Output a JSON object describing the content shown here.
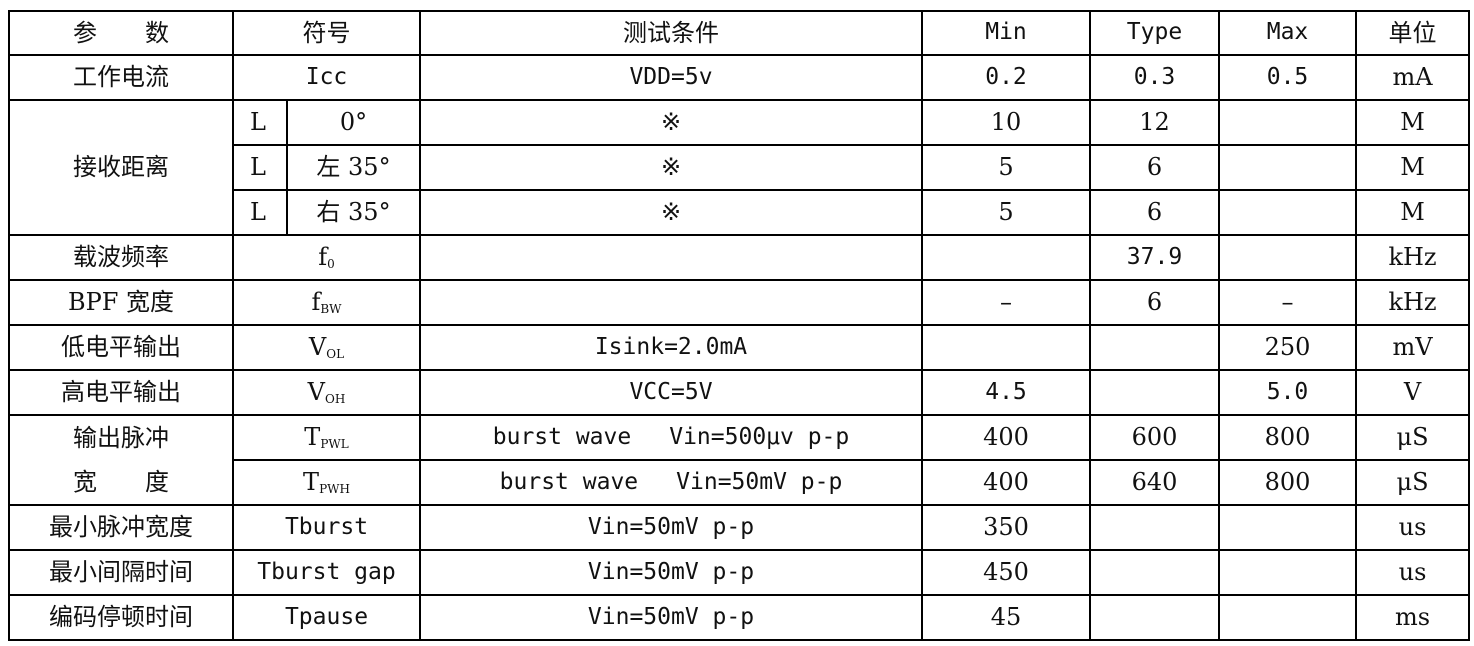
{
  "header": {
    "param": "参　　数",
    "symbol": "符号",
    "condition": "测试条件",
    "min": "Min",
    "type": "Type",
    "max": "Max",
    "unit": "单位"
  },
  "rows": {
    "current": {
      "param": "工作电流",
      "symbol": "Icc",
      "condition": "VDD=5v",
      "min": "0.2",
      "type": "0.3",
      "max": "0.5",
      "unit": "mA"
    },
    "distance": {
      "param": "接收距离",
      "sub": [
        {
          "l": "L",
          "angle": "0°",
          "condition": "※",
          "min": "10",
          "type": "12",
          "max": "",
          "unit": "M"
        },
        {
          "l": "L",
          "angle": "左 35°",
          "condition": "※",
          "min": "5",
          "type": "6",
          "max": "",
          "unit": "M"
        },
        {
          "l": "L",
          "angle": "右 35°",
          "condition": "※",
          "min": "5",
          "type": "6",
          "max": "",
          "unit": "M"
        }
      ]
    },
    "carrier": {
      "param": "载波频率",
      "symbol_main": "f",
      "symbol_sub": "0",
      "condition": "",
      "min": "",
      "type": "37.9",
      "max": "",
      "unit": "kHz"
    },
    "bpf": {
      "param": "BPF 宽度",
      "symbol_main": "f",
      "symbol_sub": "BW",
      "condition": "",
      "min": "–",
      "type": "6",
      "max": "–",
      "unit": "kHz"
    },
    "vol": {
      "param": "低电平输出",
      "symbol_main": "V",
      "symbol_sub": "OL",
      "condition": "Isink=2.0mA",
      "min": "",
      "type": "",
      "max": "250",
      "unit": "mV"
    },
    "voh": {
      "param": "高电平输出",
      "symbol_main": "V",
      "symbol_sub": "OH",
      "condition": "VCC=5V",
      "min": "4.5",
      "type": "",
      "max": "5.0",
      "unit": "V"
    },
    "pulse": {
      "param_line1": "输出脉冲",
      "param_line2": "宽　　度",
      "tpwl": {
        "symbol_main": "T",
        "symbol_sub": "PWL",
        "cond_a": "burst wave",
        "cond_b": "Vin=500μv p-p",
        "min": "400",
        "type": "600",
        "max": "800",
        "unit": "μS"
      },
      "tpwh": {
        "symbol_main": "T",
        "symbol_sub": "PWH",
        "cond_a": "burst wave",
        "cond_b": "Vin=50mV p-p",
        "min": "400",
        "type": "640",
        "max": "800",
        "unit": "μS"
      }
    },
    "tburst": {
      "param": "最小脉冲宽度",
      "symbol": "Tburst",
      "condition": "Vin=50mV p-p",
      "min": "350",
      "type": "",
      "max": "",
      "unit": "us"
    },
    "gap": {
      "param": "最小间隔时间",
      "symbol": "Tburst gap",
      "condition": "Vin=50mV p-p",
      "min": "450",
      "type": "",
      "max": "",
      "unit": "us"
    },
    "pause": {
      "param": "编码停顿时间",
      "symbol": "Tpause",
      "condition": "Vin=50mV p-p",
      "min": "45",
      "type": "",
      "max": "",
      "unit": "ms"
    }
  }
}
